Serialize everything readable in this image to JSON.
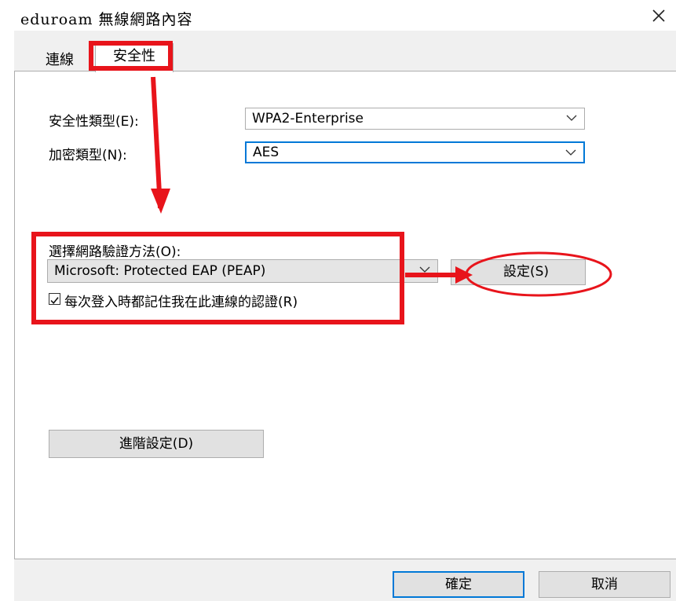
{
  "window": {
    "title": "eduroam 無線網路內容"
  },
  "tabs": [
    {
      "label": "連線",
      "active": false
    },
    {
      "label": "安全性",
      "active": true
    }
  ],
  "security": {
    "type_label": "安全性類型(E):",
    "type_value": "WPA2-Enterprise",
    "encryption_label": "加密類型(N):",
    "encryption_value": "AES"
  },
  "auth": {
    "method_label": "選擇網路驗證方法(O):",
    "method_value": "Microsoft: Protected EAP (PEAP)",
    "settings_button": "設定(S)",
    "remember_checkbox_label": "每次登入時都記住我在此連線的認證(R)",
    "remember_checked": true
  },
  "advanced_button": "進階設定(D)",
  "footer": {
    "ok_label": "確定",
    "cancel_label": "取消"
  },
  "colors": {
    "annotation_red": "#e8141b",
    "focus_blue": "#0078d7",
    "dialog_gray": "#f0f0f0"
  }
}
